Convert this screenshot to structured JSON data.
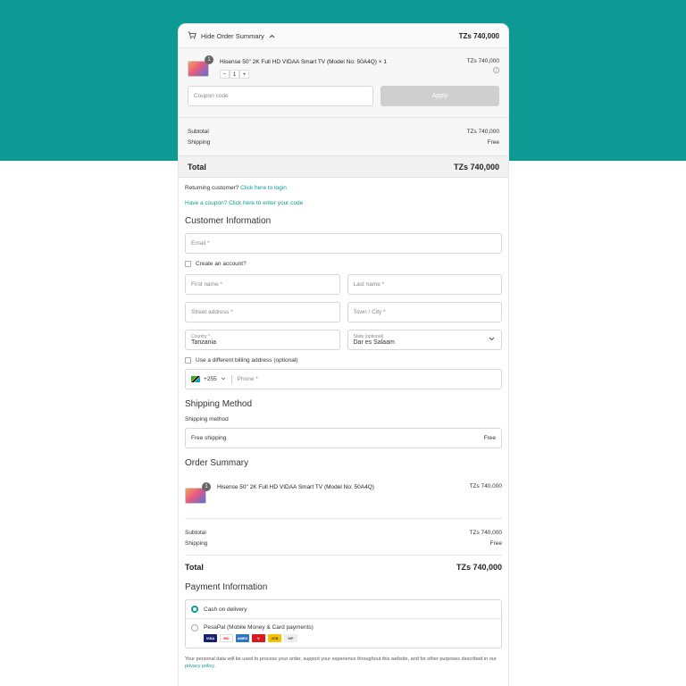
{
  "summary": {
    "toggle_label": "Hide Order Summary",
    "total": "TZs 740,000",
    "product": {
      "name": "Hisense 50\" 2K Full HD VIDAA Smart TV (Model No: 50A4Q) × 1",
      "qty_badge": "1",
      "qty": "1",
      "minus": "−",
      "plus": "+",
      "price": "TZs 740,000"
    },
    "coupon_placeholder": "Coupon code",
    "apply_label": "Apply",
    "subtotal_label": "Subtotal",
    "subtotal_value": "TZs 740,000",
    "shipping_label": "Shipping",
    "shipping_value": "Free",
    "total_label": "Total",
    "total_value": "TZs 740,000"
  },
  "returning": {
    "prefix": "Returning customer?",
    "link": "Click here to login"
  },
  "coupon_link": "Have a coupon? Click here to enter your code",
  "customer": {
    "title": "Customer Information",
    "email_placeholder": "Email *",
    "create_account": "Create an account?",
    "first_name": "First name *",
    "last_name": "Last name *",
    "street": "Street address *",
    "town": "Town / City *",
    "country_label": "Country *",
    "country_value": "Tanzania",
    "state_label": "State (optional)",
    "state_value": "Dar es Salaam",
    "diff_billing": "Use a different billing address (optional)",
    "phone_code": "+255",
    "phone_placeholder": "Phone *"
  },
  "shipping": {
    "title": "Shipping Method",
    "label": "Shipping method",
    "option": "Free shipping",
    "option_value": "Free"
  },
  "order_summary": {
    "title": "Order Summary",
    "product_name": "Hisense 50\" 2K Full HD VIDAA Smart TV (Model No: 50A4Q)",
    "qty_badge": "1",
    "price": "TZs 740,000",
    "subtotal_label": "Subtotal",
    "subtotal_value": "TZs 740,000",
    "shipping_label": "Shipping",
    "shipping_value": "Free",
    "total_label": "Total",
    "total_value": "TZs 740,000"
  },
  "payment": {
    "title": "Payment Information",
    "option_cod": "Cash on delivery",
    "option_pesapal": "PesaPal (Mobile Money & Card payments)",
    "card_logos": [
      "VISA",
      "MC",
      "AMEX",
      "V",
      "JCB",
      "MP"
    ]
  },
  "privacy": {
    "text": "Your personal data will be used to process your order, support your experience throughout this website, and for other purposes described in our",
    "link": "privacy policy."
  },
  "colors": {
    "accent": "#0e9a94",
    "apply_disabled": "#cfcfcf"
  }
}
